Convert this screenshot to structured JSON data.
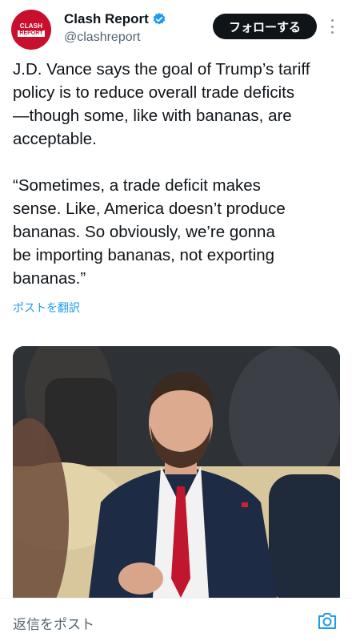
{
  "header": {
    "avatar_line1": "CLASH",
    "avatar_line2": "REPORT",
    "display_name": "Clash Report",
    "handle": "@clashreport",
    "follow_label": "フォローする"
  },
  "tweet": {
    "text": "J.D. Vance says the goal of Trump’s tariff\npolicy is to reduce overall trade deficits\n—though some, like with bananas, are\nacceptable.\n\n“Sometimes, a trade deficit makes\nsense. Like, America doesn’t produce\nbananas. So obviously, we’re gonna\nbe importing bananas, not exporting\nbananas.”",
    "translate_label": "ポストを翻訳"
  },
  "footer": {
    "reply_placeholder": "返信をポスト"
  },
  "colors": {
    "accent": "#1d9bf0",
    "follow_bg": "#0f1419",
    "avatar_bg": "#c8102e"
  },
  "icons": [
    "verified-badge-icon",
    "more-options-icon",
    "camera-icon"
  ]
}
